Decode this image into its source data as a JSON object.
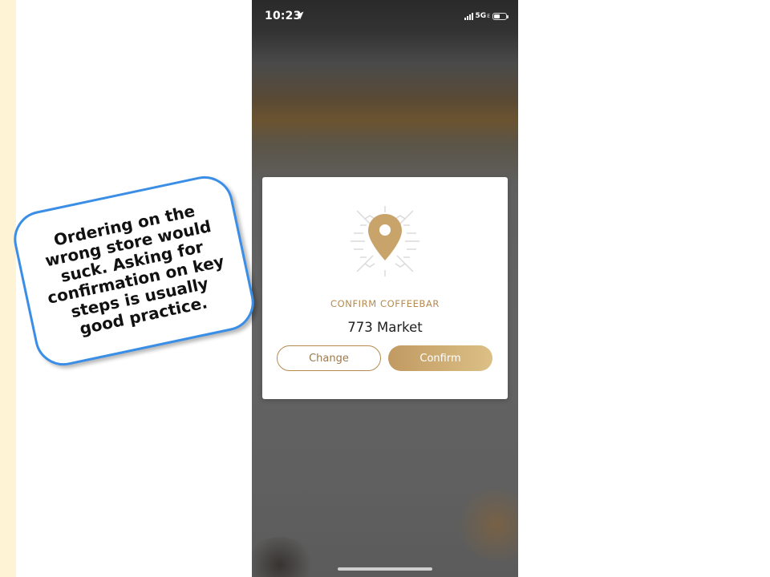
{
  "status_bar": {
    "time": "10:23",
    "network": "5G",
    "network_sub": "E"
  },
  "dialog": {
    "label": "CONFIRM COFFEEBAR",
    "store_name": "773 Market",
    "change_label": "Change",
    "confirm_label": "Confirm"
  },
  "callout": {
    "text": "Ordering on the wrong store would suck. Asking for confirmation on key steps is usually good practice."
  },
  "colors": {
    "accent_gold": "#b48a4f",
    "callout_border": "#3a8ee6",
    "side_strip": "#fff3d6"
  },
  "icons": {
    "location_arrow": "location-arrow-icon",
    "signal": "signal-icon",
    "battery": "battery-icon",
    "pin": "map-pin-icon"
  }
}
